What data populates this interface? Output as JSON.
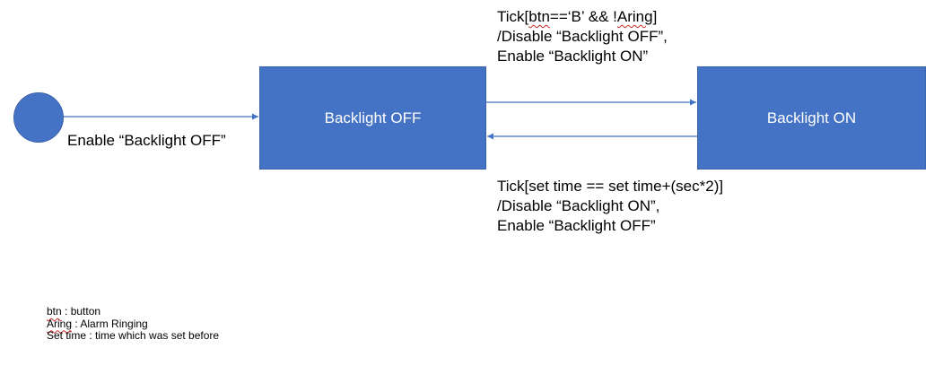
{
  "states": {
    "off": {
      "label": "Backlight OFF"
    },
    "on": {
      "label": "Backlight ON"
    }
  },
  "transitions": {
    "initial": {
      "label": "Enable “Backlight OFF”"
    },
    "off_to_on": {
      "guard_prefix": "Tick[",
      "guard_var1": "btn",
      "guard_middle": "==‘B’ && !",
      "guard_var2": "Aring",
      "guard_suffix": "]",
      "action_line1": "/Disable “Backlight OFF”,",
      "action_line2": "Enable “Backlight ON”"
    },
    "on_to_off": {
      "guard": "Tick[set time == set time+(sec*2)]",
      "action_line1": "/Disable “Backlight ON”,",
      "action_line2": "Enable “Backlight OFF”"
    }
  },
  "legend": {
    "btn_term": "btn",
    "btn_def": " : button",
    "aring_term": "Aring",
    "aring_def": " : Alarm Ringing",
    "settime_line": "Set time : time which was set before"
  },
  "colors": {
    "state_fill": "#4472c4",
    "arrow": "#4472c4",
    "spellcheck_underline": "#d02a2a"
  }
}
